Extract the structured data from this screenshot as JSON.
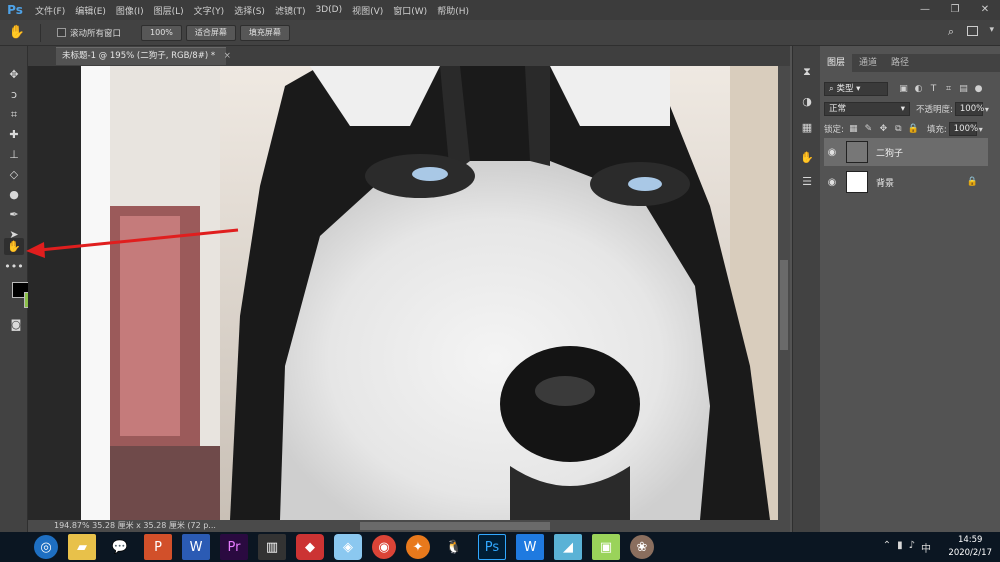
{
  "app": {
    "logo": "Ps",
    "menu": [
      "文件(F)",
      "编辑(E)",
      "图像(I)",
      "图层(L)",
      "文字(Y)",
      "选择(S)",
      "滤镜(T)",
      "3D(D)",
      "视图(V)",
      "窗口(W)",
      "帮助(H)"
    ]
  },
  "options_bar": {
    "scroll_all_windows_label": "滚动所有窗口",
    "zoom_value": "100%",
    "fit_screen_label": "适合屏幕",
    "fill_screen_label": "填充屏幕"
  },
  "document": {
    "tab_title": "未标题-1 @ 195% (二狗子, RGB/8#) *",
    "status": "194.87%  35.28 厘米 x 35.28 厘米 (72 p..."
  },
  "layers_panel": {
    "tabs": [
      "图层",
      "通道",
      "路径"
    ],
    "filter_kind": "类型",
    "blend_mode": "正常",
    "opacity_label": "不透明度:",
    "opacity_value": "100%",
    "lock_label": "锁定:",
    "fill_label": "填充:",
    "fill_value": "100%",
    "layers": [
      {
        "name": "二狗子",
        "selected": true
      },
      {
        "name": "背景",
        "selected": false,
        "locked": true
      }
    ]
  },
  "taskbar": {
    "apps": [
      "browser-icon",
      "file-explorer-icon",
      "wechat-icon",
      "powerpoint-icon",
      "word-icon",
      "premiere-icon",
      "video-editor-icon",
      "app-icon",
      "app-icon",
      "chrome-icon",
      "app-icon",
      "qq-icon",
      "photoshop-icon",
      "wps-icon",
      "app-icon",
      "app-icon",
      "app-icon"
    ],
    "time": "14:59",
    "date": "2020/2/17"
  },
  "colors": {
    "foreground": "#000000",
    "background": "#8cc04b",
    "annotation_arrow": "#e01e1e"
  }
}
